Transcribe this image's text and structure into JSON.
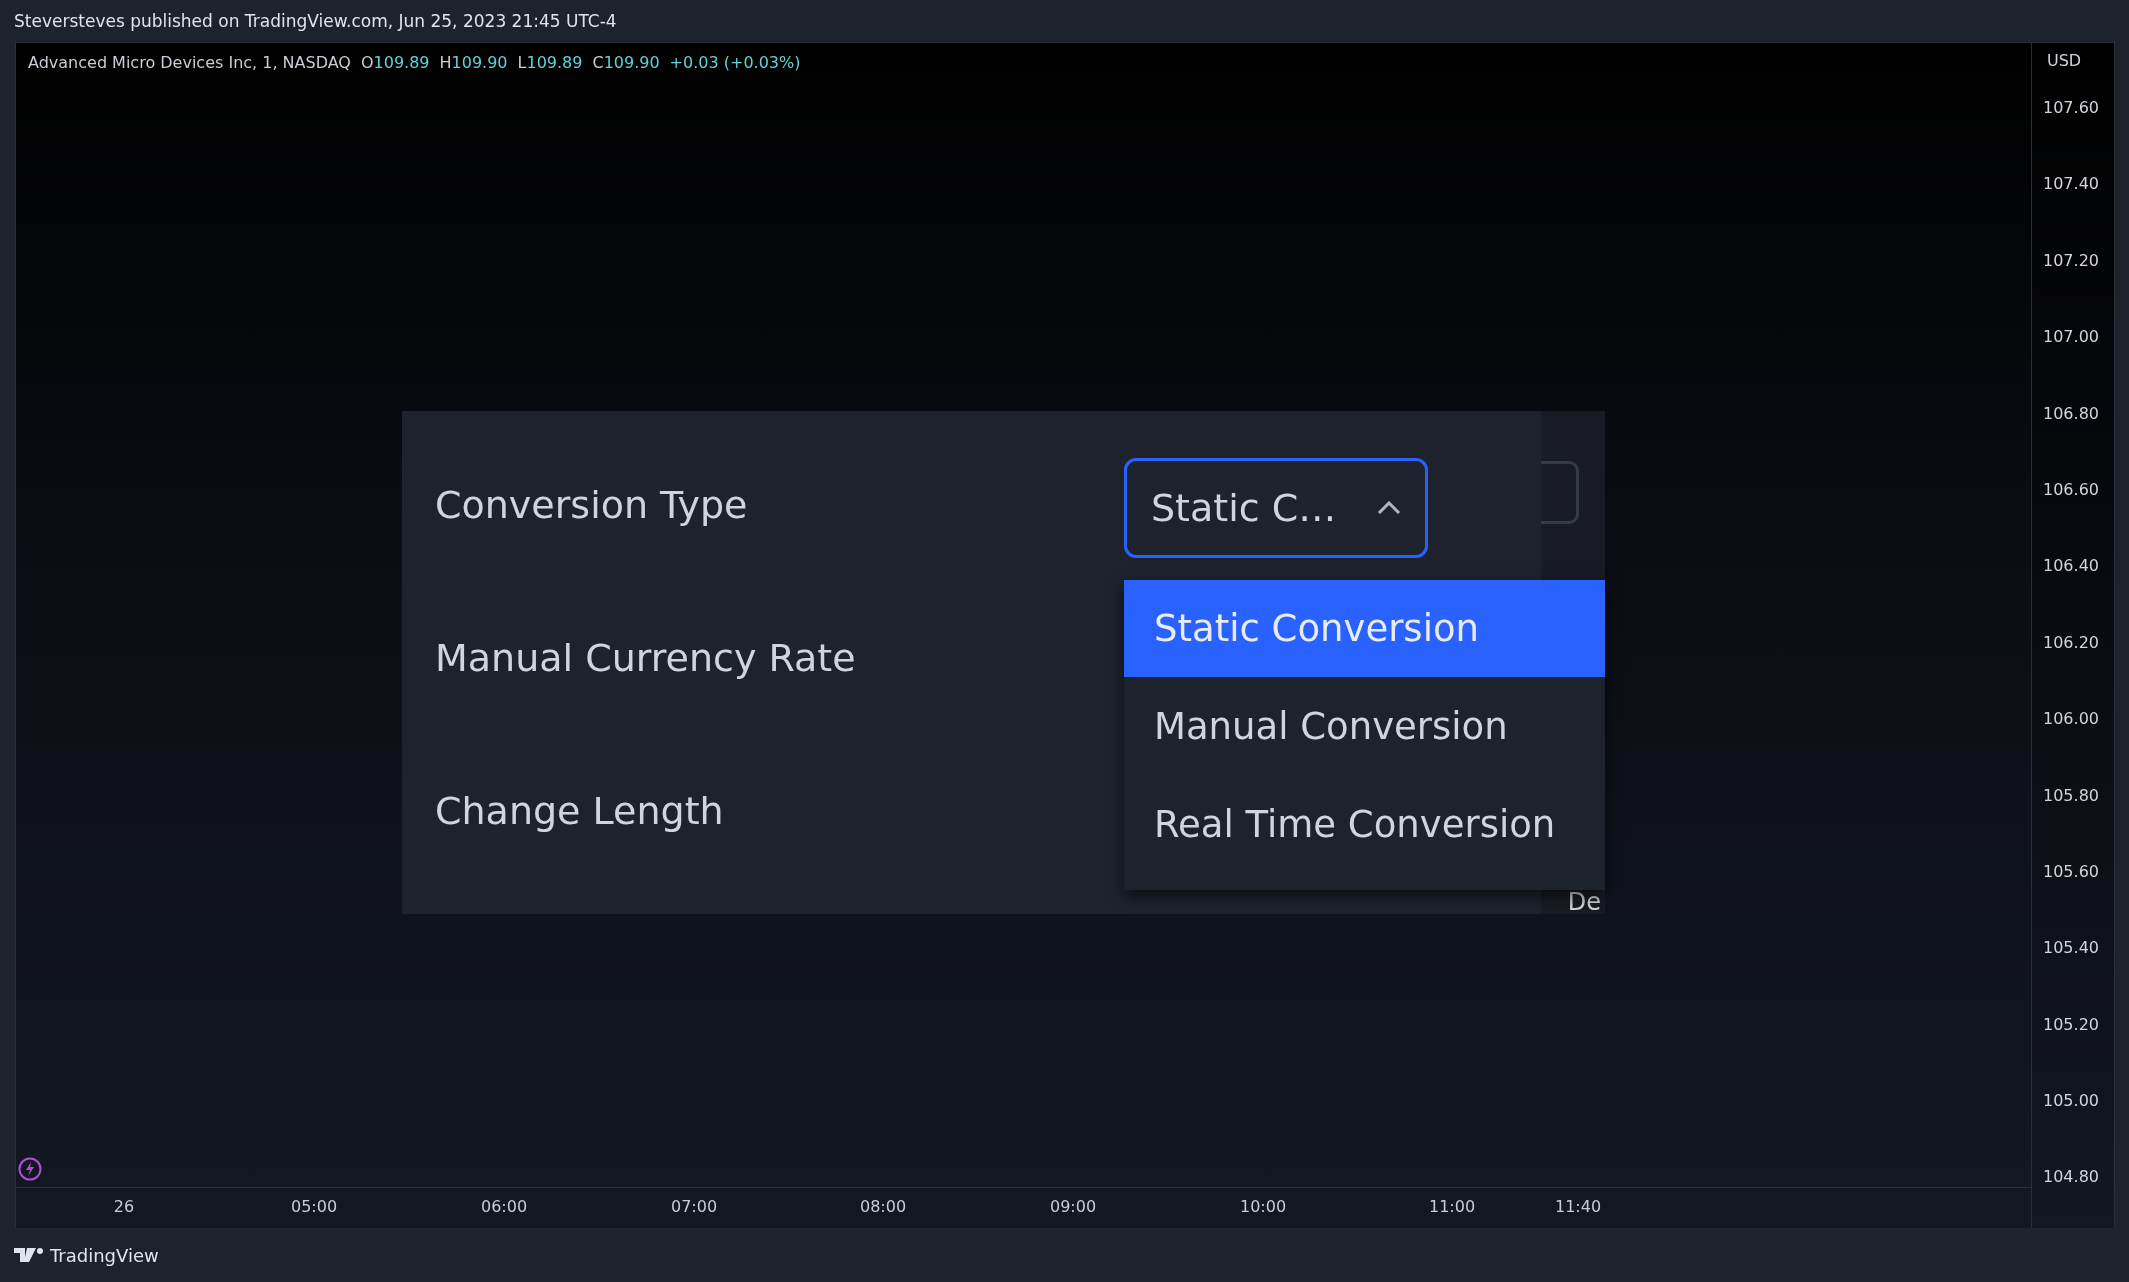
{
  "header": {
    "title": "Steversteves published on TradingView.com, Jun 25, 2023 21:45 UTC-4"
  },
  "legend": {
    "symbol": "Advanced Micro Devices Inc, 1, NASDAQ",
    "ohlc": [
      {
        "label": "O",
        "value": "109.89"
      },
      {
        "label": "H",
        "value": "109.90"
      },
      {
        "label": "L",
        "value": "109.89"
      },
      {
        "label": "C",
        "value": "109.90"
      }
    ],
    "change": "+0.03 (+0.03%)"
  },
  "price_axis": {
    "currency": "USD",
    "labels": [
      "107.60",
      "107.40",
      "107.20",
      "107.00",
      "106.80",
      "106.60",
      "106.40",
      "106.20",
      "106.00",
      "105.80",
      "105.60",
      "105.40",
      "105.20",
      "105.00",
      "104.80"
    ]
  },
  "time_axis": {
    "labels": [
      "26",
      "05:00",
      "06:00",
      "07:00",
      "08:00",
      "09:00",
      "10:00",
      "11:00",
      "11:40"
    ]
  },
  "settings": {
    "rows": [
      {
        "label": "Conversion Type"
      },
      {
        "label": "Manual Currency Rate"
      },
      {
        "label": "Change Length"
      }
    ],
    "select": {
      "value": "Static C…",
      "expanded": true
    },
    "options": [
      {
        "label": "Static Conversion",
        "selected": true
      },
      {
        "label": "Manual Conversion",
        "selected": false
      },
      {
        "label": "Real Time Conversion",
        "selected": false
      }
    ],
    "cut_text": "De"
  },
  "footer": {
    "brand": "TradingView"
  }
}
